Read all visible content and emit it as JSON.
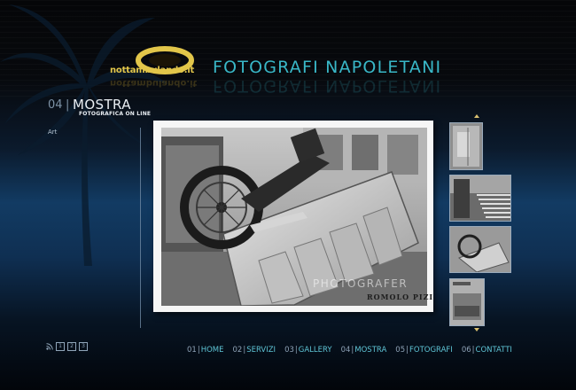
{
  "brand": {
    "logo_text": "nottambulando.it",
    "site_title": "FOTOGRAFI NAPOLETANI"
  },
  "section": {
    "number": "04",
    "separator": "|",
    "name": "MOSTRA",
    "subtitle": "FOTOGRAFICA ON LINE",
    "category": "Art"
  },
  "photo": {
    "watermark_title": "PHOTOGRAFER",
    "author": "ROMOLO PIZI"
  },
  "pagination": [
    "1",
    "2",
    "3"
  ],
  "nav": [
    {
      "num": "01",
      "sep": "|",
      "label": "HOME"
    },
    {
      "num": "02",
      "sep": "|",
      "label": "SERVIZI"
    },
    {
      "num": "03",
      "sep": "|",
      "label": "GALLERY"
    },
    {
      "num": "04",
      "sep": "|",
      "label": "MOSTRA"
    },
    {
      "num": "05",
      "sep": "|",
      "label": "FOTOGRAFI"
    },
    {
      "num": "06",
      "sep": "|",
      "label": "CONTATTI"
    }
  ],
  "colors": {
    "accent_teal": "#39b7c7",
    "logo_gold": "#e2c64a",
    "nav_label": "#5fc5d6"
  },
  "icons": [
    "rss-icon",
    "scroll-up-arrow-icon",
    "scroll-down-arrow-icon"
  ]
}
